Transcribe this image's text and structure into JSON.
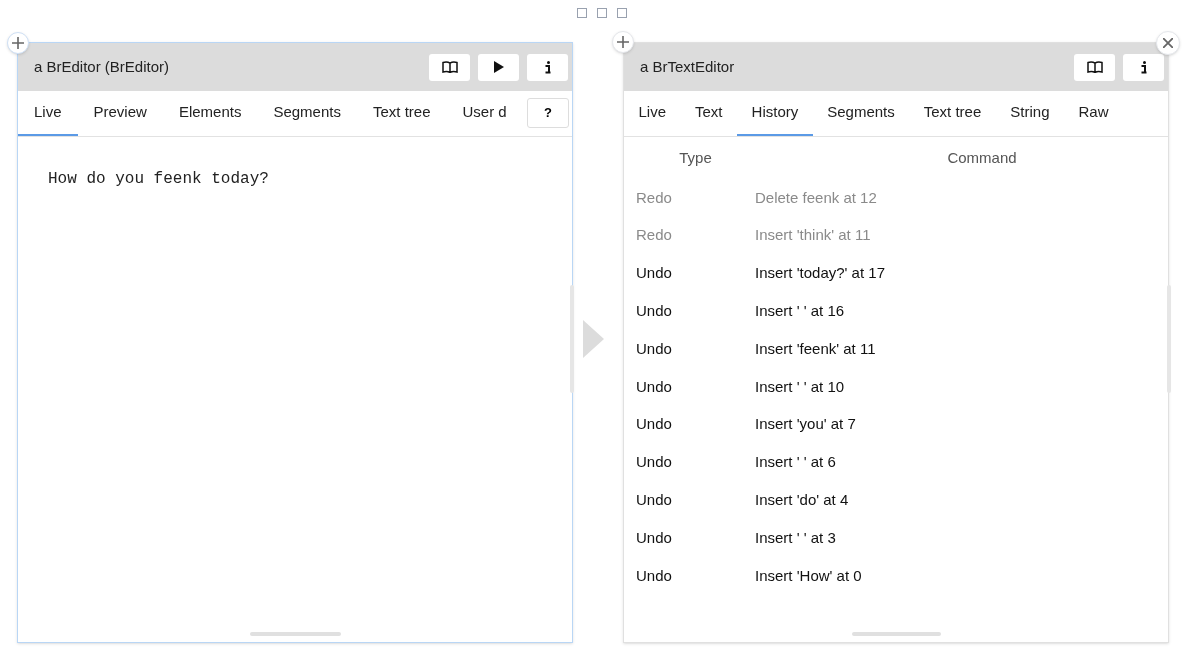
{
  "left_panel": {
    "title": "a BrEditor (BrEditor)",
    "header_buttons": [
      {
        "kind": "book"
      },
      {
        "kind": "play"
      },
      {
        "kind": "info"
      }
    ],
    "tabs": [
      {
        "label": "Live",
        "selected": true
      },
      {
        "label": "Preview",
        "selected": false
      },
      {
        "label": "Elements",
        "selected": false
      },
      {
        "label": "Segments",
        "selected": false
      },
      {
        "label": "Text tree",
        "selected": false
      },
      {
        "label": "User d",
        "selected": false
      }
    ],
    "help_button": "?",
    "editor_text": "How do you feenk today?"
  },
  "right_panel": {
    "title": "a BrTextEditor",
    "header_buttons": [
      {
        "kind": "book"
      },
      {
        "kind": "info"
      }
    ],
    "tabs": [
      {
        "label": "Live",
        "selected": false
      },
      {
        "label": "Text",
        "selected": false
      },
      {
        "label": "History",
        "selected": true
      },
      {
        "label": "Segments",
        "selected": false
      },
      {
        "label": "Text tree",
        "selected": false
      },
      {
        "label": "String",
        "selected": false
      },
      {
        "label": "Raw",
        "selected": false
      }
    ],
    "table": {
      "columns": [
        "Type",
        "Command"
      ],
      "rows": [
        {
          "type": "Redo",
          "command": "Delete feenk at 12",
          "dimmed": true
        },
        {
          "type": "Redo",
          "command": "Insert 'think' at 11",
          "dimmed": true
        },
        {
          "type": "Undo",
          "command": "Insert 'today?' at 17",
          "dimmed": false
        },
        {
          "type": "Undo",
          "command": "Insert ' ' at 16",
          "dimmed": false
        },
        {
          "type": "Undo",
          "command": "Insert 'feenk' at 11",
          "dimmed": false
        },
        {
          "type": "Undo",
          "command": "Insert ' ' at 10",
          "dimmed": false
        },
        {
          "type": "Undo",
          "command": "Insert 'you' at 7",
          "dimmed": false
        },
        {
          "type": "Undo",
          "command": "Insert ' ' at 6",
          "dimmed": false
        },
        {
          "type": "Undo",
          "command": "Insert 'do' at 4",
          "dimmed": false
        },
        {
          "type": "Undo",
          "command": "Insert ' ' at 3",
          "dimmed": false
        },
        {
          "type": "Undo",
          "command": "Insert 'How' at 0",
          "dimmed": false
        }
      ]
    }
  }
}
